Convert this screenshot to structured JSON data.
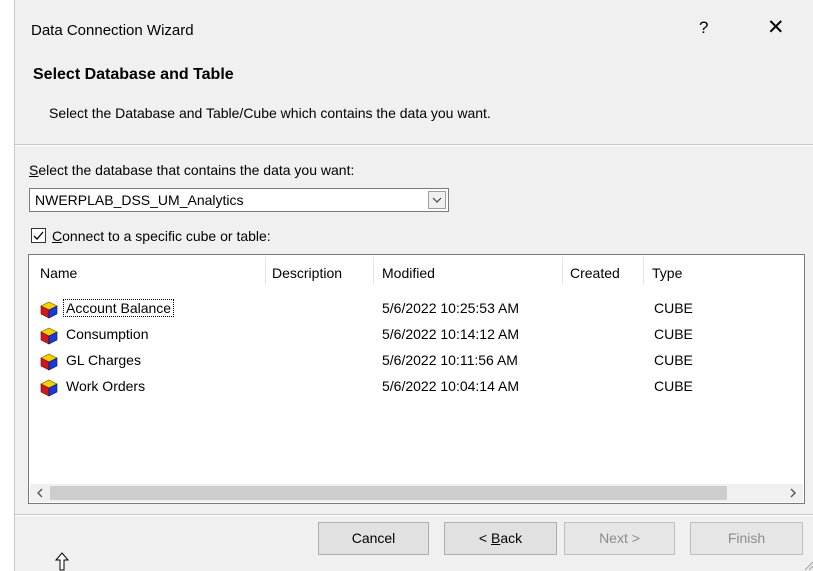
{
  "window": {
    "title": "Data Connection Wizard",
    "help": "?",
    "close": "✕"
  },
  "header": {
    "title": "Select Database and Table",
    "subtitle": "Select the Database and Table/Cube which contains the data you want."
  },
  "database": {
    "label_accel": "S",
    "label_rest": "elect the database that contains the data you want:",
    "selected": "NWERPLAB_DSS_UM_Analytics"
  },
  "cube_option": {
    "checked": true,
    "label_accel": "C",
    "label_rest": "onnect to a specific cube or table:"
  },
  "table": {
    "columns": [
      "Name",
      "Description",
      "Modified",
      "Created",
      "Type"
    ],
    "rows": [
      {
        "name": "Account Balance",
        "description": "",
        "modified": "5/6/2022 10:25:53 AM",
        "created": "",
        "type": "CUBE",
        "focused": true
      },
      {
        "name": "Consumption",
        "description": "",
        "modified": "5/6/2022 10:14:12 AM",
        "created": "",
        "type": "CUBE"
      },
      {
        "name": "GL Charges",
        "description": "",
        "modified": "5/6/2022 10:11:56 AM",
        "created": "",
        "type": "CUBE"
      },
      {
        "name": "Work Orders",
        "description": "",
        "modified": "5/6/2022 10:04:14 AM",
        "created": "",
        "type": "CUBE"
      }
    ],
    "row_icon": "cube-icon"
  },
  "buttons": {
    "cancel": "Cancel",
    "back_prefix": "< ",
    "back_accel": "B",
    "back_rest": "ack",
    "next": "Next >",
    "finish": "Finish"
  },
  "colors": {
    "accent": "#1f7a7c",
    "dialog_bg": "#f0f0f0",
    "button_bg": "#e1e1e1"
  }
}
